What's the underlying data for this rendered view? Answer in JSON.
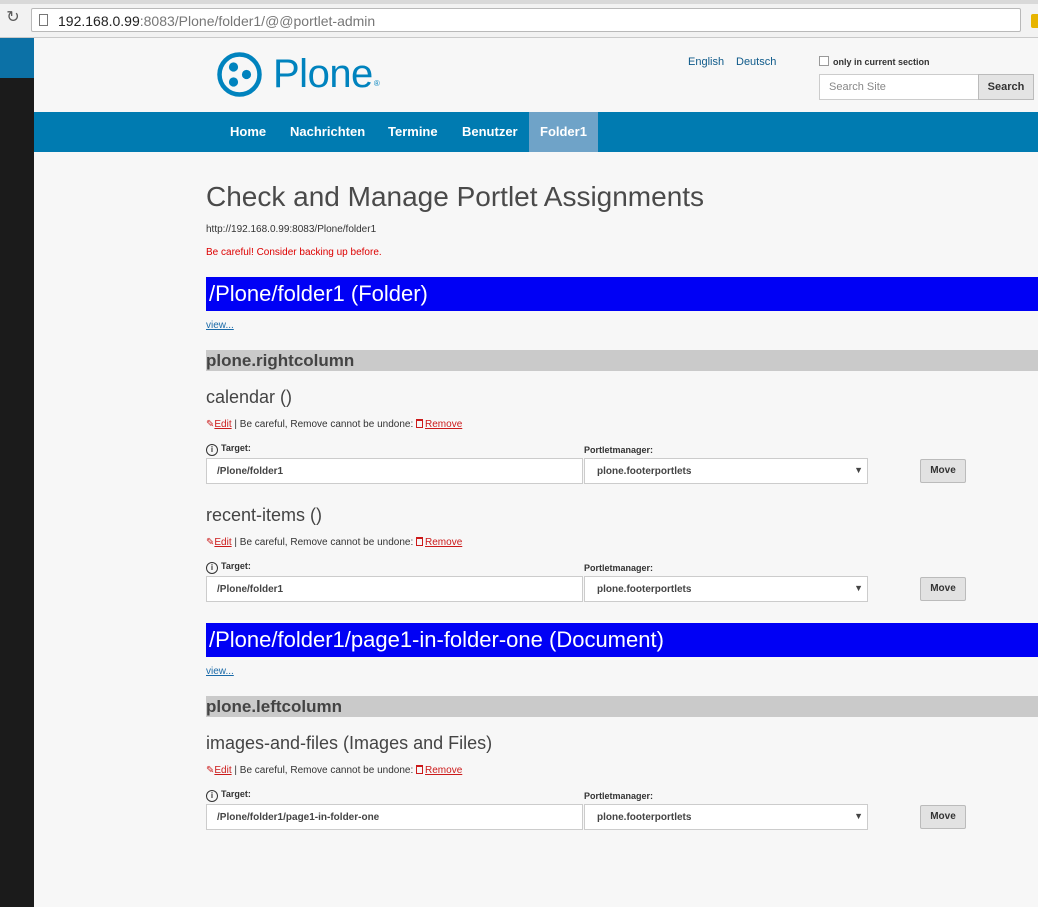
{
  "browser": {
    "url_host": "192.168.0.99",
    "url_rest": ":8083/Plone/folder1/@@portlet-admin"
  },
  "header": {
    "logo_text": "Plone",
    "logo_reg": "®",
    "languages": [
      "English",
      "Deutsch"
    ],
    "only_in_section_label": "only in current section",
    "search_placeholder": "Search Site",
    "search_button": "Search"
  },
  "nav": {
    "items": [
      "Home",
      "Nachrichten",
      "Termine",
      "Benutzer",
      "Folder1"
    ],
    "active_index": 4
  },
  "main": {
    "title": "Check and Manage Portlet Assignments",
    "url": "http://192.168.0.99:8083/Plone/folder1",
    "warning": "Be careful! Consider backing up before.",
    "sections": [
      {
        "heading": "/Plone/folder1 (Folder)",
        "view_link": "view...",
        "column": "plone.rightcolumn",
        "portlets": [
          {
            "title": "calendar ()",
            "target": "/Plone/folder1",
            "manager": "plone.footerportlets"
          },
          {
            "title": "recent-items ()",
            "target": "/Plone/folder1",
            "manager": "plone.footerportlets"
          }
        ]
      },
      {
        "heading": "/Plone/folder1/page1-in-folder-one (Document)",
        "view_link": "view...",
        "column": "plone.leftcolumn",
        "portlets": [
          {
            "title": "images-and-files (Images and Files)",
            "target": "/Plone/folder1/page1-in-folder-one",
            "manager": "plone.footerportlets"
          }
        ]
      }
    ],
    "labels": {
      "edit": "Edit",
      "careful": " | Be careful, Remove cannot be undone: ",
      "remove": "Remove",
      "target": "Target:",
      "manager": "Portletmanager:",
      "move": "Move"
    }
  },
  "colors": {
    "plone_blue": "#0083be",
    "nav_blue": "#007bb1",
    "nav_active": "#6fa3c8",
    "object_heading_bg": "#0000f5",
    "column_heading_bg": "#cacaca",
    "warning_red": "#dd0000"
  }
}
